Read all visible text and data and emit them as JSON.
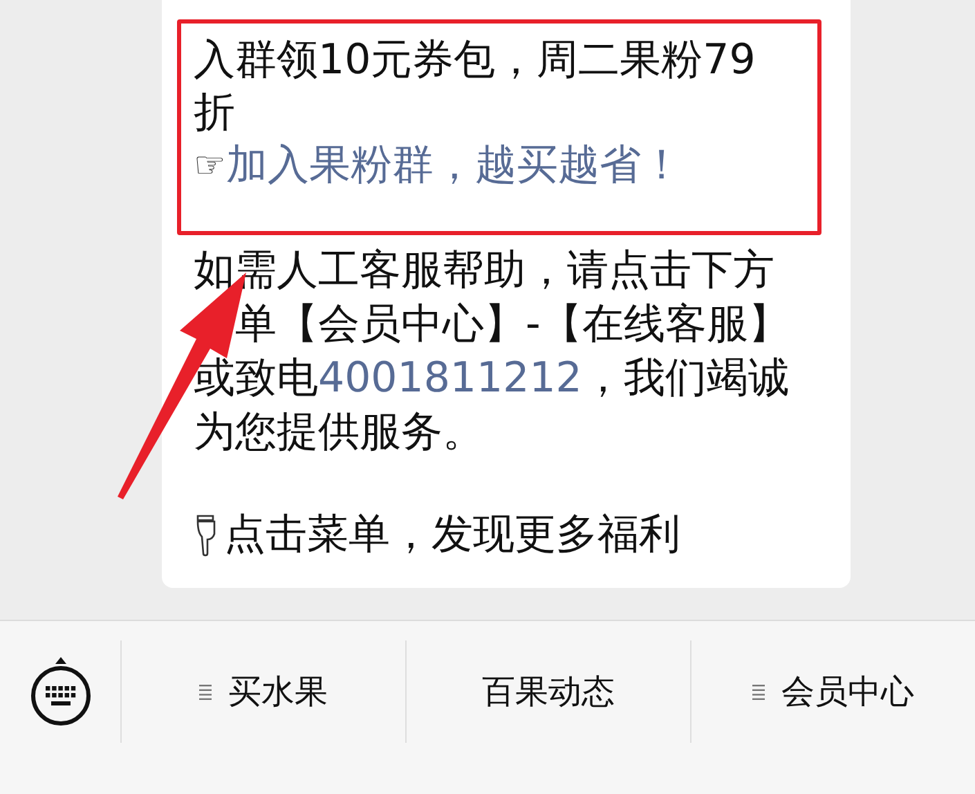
{
  "message": {
    "promo": {
      "text": "入群领10元券包，周二果粉79折",
      "link_icon": "☞",
      "link": "加入果粉群，越买越省！"
    },
    "help": {
      "before": "如需人工客服帮助，请点击下方",
      "before_after_arrow": "单【会员中心】-【在线客服】或致电",
      "phone": "4001811212",
      "after": "，我们竭诚为您提供服务。"
    },
    "footer": "点击菜单，发现更多福利"
  },
  "menu": [
    {
      "label": "买水果",
      "has_submenu": true
    },
    {
      "label": "百果动态",
      "has_submenu": false
    },
    {
      "label": "会员中心",
      "has_submenu": true
    }
  ]
}
